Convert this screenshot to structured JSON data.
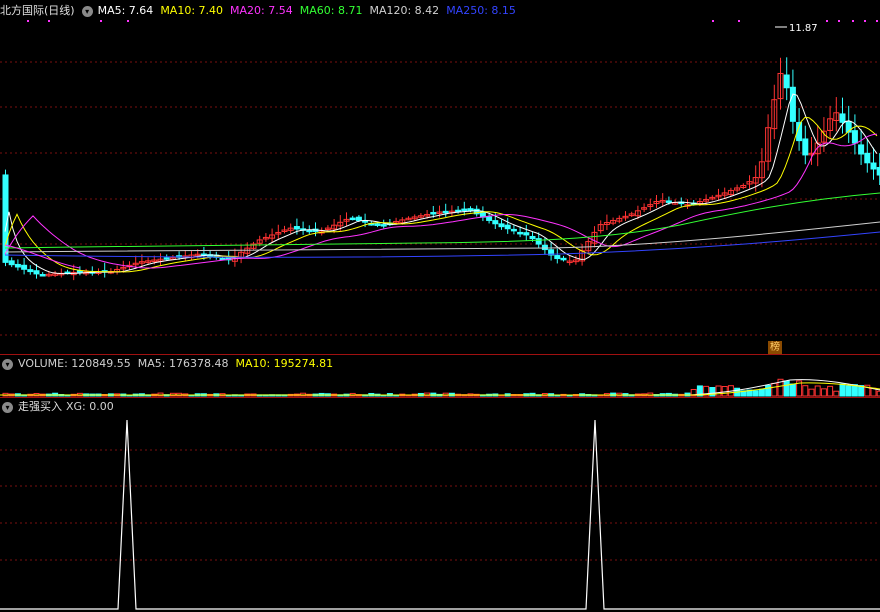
{
  "main_panel": {
    "title": "北方国际(日线)",
    "indicators": [
      {
        "label": "MA5: 7.64",
        "color": "#ffffff"
      },
      {
        "label": "MA10: 7.40",
        "color": "#ffff00"
      },
      {
        "label": "MA20: 7.54",
        "color": "#ff33ff"
      },
      {
        "label": "MA60: 8.71",
        "color": "#33ff33"
      },
      {
        "label": "MA120: 8.42",
        "color": "#d0d0d0"
      },
      {
        "label": "MA250: 8.15",
        "color": "#3344ff"
      }
    ],
    "high_label": "11.87",
    "badge": "榜"
  },
  "volume_panel": {
    "indicators": [
      {
        "label": "VOLUME: 120849.55",
        "color": "#d0d0d0"
      },
      {
        "label": "MA5: 176378.48",
        "color": "#d0d0d0"
      },
      {
        "label": "MA10: 195274.81",
        "color": "#ffff00"
      }
    ]
  },
  "signal_panel": {
    "title": "走强买入",
    "indicators": [
      {
        "label": "XG: 0.00",
        "color": "#d0d0d0"
      }
    ]
  },
  "colors": {
    "up": "#ff3333",
    "down": "#33ffff",
    "grid": "#7a1010",
    "divider": "#a01010"
  }
}
